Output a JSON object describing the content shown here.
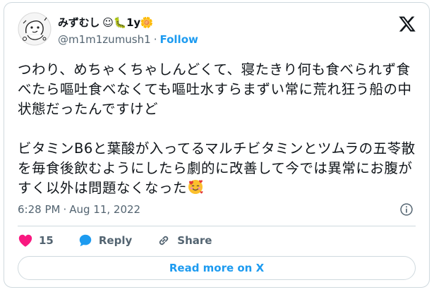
{
  "author": {
    "display_name": "みずむし",
    "name_emojis": "☺🐛1y🌼",
    "handle": "@m1m1zumush1",
    "separator": "·",
    "follow_label": "Follow"
  },
  "tweet": {
    "paragraph1": "つわり、めちゃくちゃしんどくて、寝たきり何も食べられず食べたら嘔吐食べなくても嘔吐水すらまずい常に荒れ狂う船の中状態だったんですけど",
    "paragraph2": "ビタミンB6と葉酸が入ってるマルチビタミンとツムラの五苓散を毎食後飲むようにしたら劇的に改善して今では異常にお腹がすく以外は問題なくなった"
  },
  "meta": {
    "time": "6:28 PM",
    "separator": "·",
    "date": "Aug 11, 2022"
  },
  "actions": {
    "like_count": "15",
    "reply_label": "Reply",
    "share_label": "Share"
  },
  "read_more_label": "Read more on X",
  "colors": {
    "accent": "#1d9bf0",
    "heart": "#f91880",
    "text": "#0f1419",
    "muted": "#536471",
    "border": "#cfd9de"
  },
  "icons": [
    "x-logo-icon",
    "info-icon",
    "heart-icon",
    "reply-bubble-icon",
    "share-link-icon",
    "smiling-face-with-hearts-icon"
  ]
}
